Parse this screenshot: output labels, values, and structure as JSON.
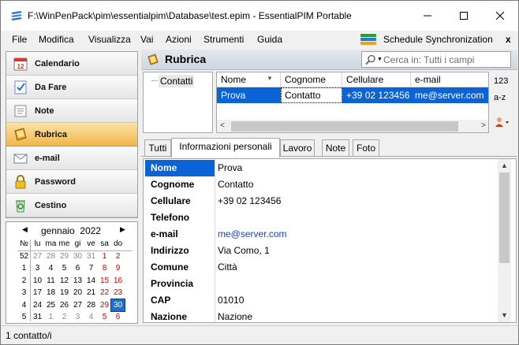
{
  "window": {
    "title": "F:\\WinPenPack\\pim\\essentialpim\\Database\\test.epim - EssentialPIM Portable"
  },
  "menu": {
    "items": [
      "File",
      "Modifica",
      "Visualizza",
      "Vai",
      "Azioni",
      "Strumenti",
      "Guida"
    ],
    "sync_label": "Schedule Synchronization",
    "close_label": "x"
  },
  "sidebar": {
    "items": [
      {
        "label": "Calendario",
        "icon": "calendar-icon"
      },
      {
        "label": "Da Fare",
        "icon": "todo-icon"
      },
      {
        "label": "Note",
        "icon": "note-icon"
      },
      {
        "label": "Rubrica",
        "icon": "address-book-icon",
        "active": true
      },
      {
        "label": "e-mail",
        "icon": "email-icon"
      },
      {
        "label": "Password",
        "icon": "lock-icon"
      },
      {
        "label": "Cestino",
        "icon": "recycle-bin-icon"
      }
    ]
  },
  "calendar": {
    "month_label": "gennaio",
    "year_label": "2022",
    "week_header": "№",
    "day_headers": [
      "lu",
      "ma",
      "me",
      "gi",
      "ve",
      "sa",
      "do"
    ],
    "weeks": [
      {
        "wk": "52",
        "days": [
          "27",
          "28",
          "29",
          "30",
          "31",
          "1",
          "2"
        ]
      },
      {
        "wk": "1",
        "days": [
          "3",
          "4",
          "5",
          "6",
          "7",
          "8",
          "9"
        ]
      },
      {
        "wk": "2",
        "days": [
          "10",
          "11",
          "12",
          "13",
          "14",
          "15",
          "16"
        ]
      },
      {
        "wk": "3",
        "days": [
          "17",
          "18",
          "19",
          "20",
          "21",
          "22",
          "23"
        ]
      },
      {
        "wk": "4",
        "days": [
          "24",
          "25",
          "26",
          "27",
          "28",
          "29",
          "30"
        ]
      },
      {
        "wk": "5",
        "days": [
          "31",
          "1",
          "2",
          "3",
          "4",
          "5",
          "6"
        ]
      }
    ],
    "today": "30"
  },
  "main": {
    "title": "Rubrica",
    "search_placeholder": "Cerca in: Tutti i campi",
    "folder": "Contatti",
    "columns": [
      "Nome",
      "Cognome",
      "Cellulare",
      "e-mail"
    ],
    "rows": [
      {
        "nome": "Prova",
        "cognome": "Contatto",
        "cellulare": "+39 02 123456",
        "email": "me@server.com"
      }
    ],
    "sort_buttons": [
      "123",
      "a-z"
    ]
  },
  "tabs": [
    "Tutti",
    "Informazioni personali",
    "Lavoro",
    "Note",
    "Foto"
  ],
  "details": [
    {
      "label": "Nome",
      "value": "Prova"
    },
    {
      "label": "Cognome",
      "value": "Contatto"
    },
    {
      "label": "Cellulare",
      "value": "+39 02 123456"
    },
    {
      "label": "Telefono",
      "value": ""
    },
    {
      "label": "e-mail",
      "value": "me@server.com"
    },
    {
      "label": "Indirizzo",
      "value": "Via Como, 1"
    },
    {
      "label": "Comune",
      "value": "Città"
    },
    {
      "label": "Provincia",
      "value": ""
    },
    {
      "label": "CAP",
      "value": "01010"
    },
    {
      "label": "Nazione",
      "value": "Nazione"
    }
  ],
  "status": {
    "text": "1 contatto/i"
  }
}
